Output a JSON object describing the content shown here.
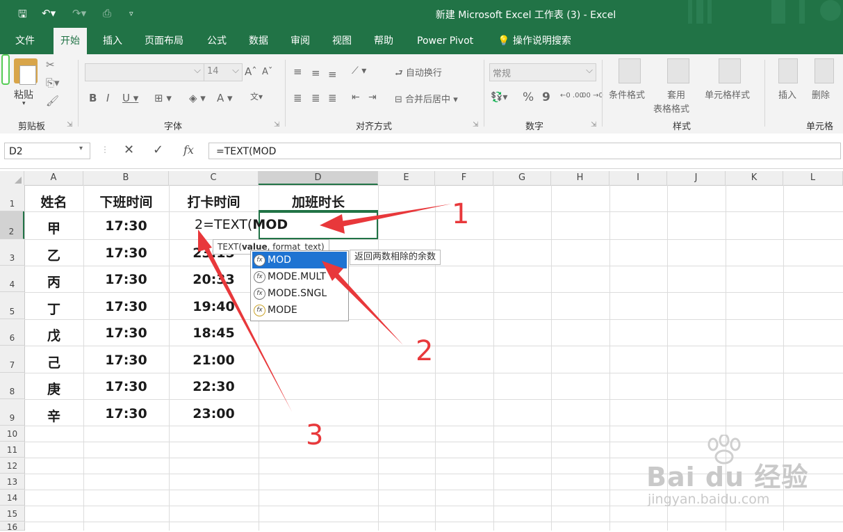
{
  "window": {
    "title": "新建 Microsoft Excel 工作表 (3)  -  Excel"
  },
  "ribbon_tabs": [
    "文件",
    "开始",
    "插入",
    "页面布局",
    "公式",
    "数据",
    "审阅",
    "视图",
    "帮助",
    "Power Pivot",
    "操作说明搜索"
  ],
  "active_tab": "开始",
  "ribbon": {
    "paste_label": "粘贴",
    "font_size": "14",
    "wrap_text": "自动换行",
    "merge_center": "合并后居中",
    "number_format": "常规",
    "percent": "%",
    "comma": "9",
    "cond_format": "条件格式",
    "table_format_1": "套用",
    "table_format_2": "表格格式",
    "cell_style": "单元格样式",
    "insert": "插入",
    "delete": "删除",
    "groups": [
      "剪贴板",
      "字体",
      "对齐方式",
      "数字",
      "样式",
      "单元格"
    ]
  },
  "formula_bar": {
    "name_box": "D2",
    "formula": "=TEXT(MOD",
    "fx": "fx"
  },
  "columns": [
    "A",
    "B",
    "C",
    "D",
    "E",
    "F",
    "G",
    "H",
    "I",
    "J",
    "K",
    "L"
  ],
  "rows": [
    "1",
    "2",
    "3",
    "4",
    "5",
    "6",
    "7",
    "8",
    "9",
    "10",
    "11",
    "12",
    "13",
    "14",
    "15",
    "16"
  ],
  "sheet": {
    "headers": [
      "姓名",
      "下班时间",
      "打卡时间",
      "加班时长"
    ],
    "names": [
      "甲",
      "乙",
      "丙",
      "丁",
      "戊",
      "己",
      "庚",
      "辛"
    ],
    "off_time": [
      "17:30",
      "17:30",
      "17:30",
      "17:30",
      "17:30",
      "17:30",
      "17:30",
      "17:30"
    ],
    "clock_in": [
      "2",
      "23:15",
      "20:33",
      "19:40",
      "18:45",
      "21:00",
      "22:30",
      "23:00"
    ]
  },
  "editing": {
    "prefix": "=TEXT(",
    "typed": "MOD"
  },
  "tooltip": {
    "fn": "TEXT(",
    "arg1": "value",
    "rest": ", format_text)"
  },
  "autocomplete": {
    "items": [
      "MOD",
      "MODE.MULT",
      "MODE.SNGL",
      "MODE"
    ],
    "selected_description": "返回两数相除的余数"
  },
  "annotations": [
    "1",
    "2",
    "3"
  ],
  "watermark": {
    "brand": "Bai du 经验",
    "url": "jingyan.baidu.com"
  },
  "colors": {
    "excel_green": "#217346",
    "annotation_red": "#e8383b",
    "selection_blue": "#1e73d2"
  }
}
